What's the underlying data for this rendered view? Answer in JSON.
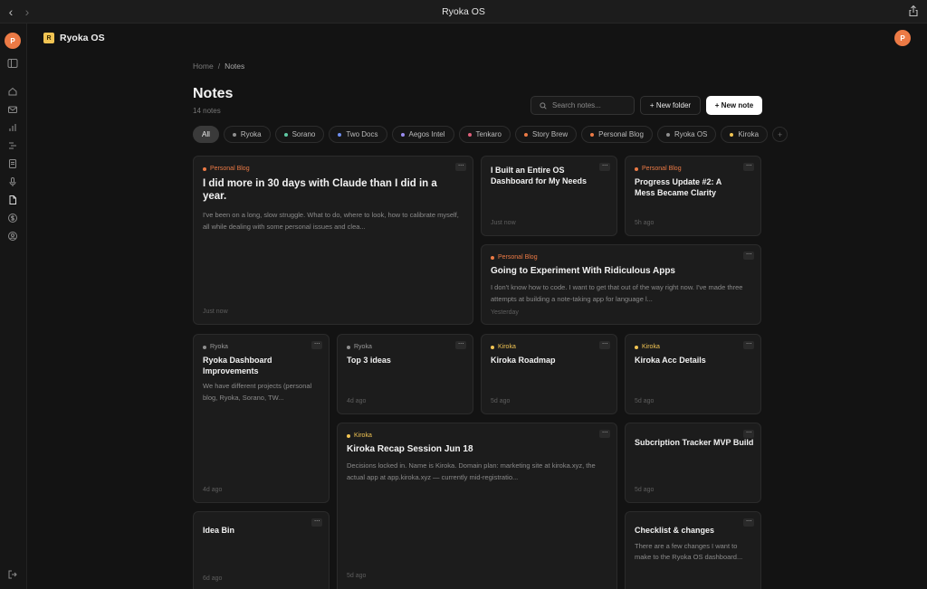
{
  "window": {
    "title": "Ryoka OS"
  },
  "rail": {
    "avatar": "P"
  },
  "app": {
    "logo": "R",
    "name": "Ryoka OS",
    "user_avatar": "P"
  },
  "breadcrumb": {
    "home": "Home",
    "sep": "/",
    "current": "Notes"
  },
  "page": {
    "title": "Notes",
    "count": "14 notes"
  },
  "search": {
    "placeholder": "Search notes..."
  },
  "buttons": {
    "new_folder": "+ New folder",
    "new_note": "+ New note"
  },
  "colors": {
    "accent": "#ec7a45",
    "kiroka": "#f1c453",
    "personal_blog": "#ec7a45",
    "ryoka": "#8f8f8f"
  },
  "filters": [
    {
      "label": "All",
      "color": ""
    },
    {
      "label": "Ryoka",
      "color": "#8f8f8f"
    },
    {
      "label": "Sorano",
      "color": "#5fc9a3"
    },
    {
      "label": "Two Docs",
      "color": "#6f8ff0"
    },
    {
      "label": "Aegos Intel",
      "color": "#9a8cf0"
    },
    {
      "label": "Tenkaro",
      "color": "#e0607a"
    },
    {
      "label": "Story Brew",
      "color": "#ec7a45"
    },
    {
      "label": "Personal Blog",
      "color": "#ec7a45"
    },
    {
      "label": "Ryoka OS",
      "color": "#8f8f8f"
    },
    {
      "label": "Kiroka",
      "color": "#f1c453"
    }
  ],
  "notes": [
    {
      "tag": "Personal Blog",
      "title": "I did more in 30 days with Claude than I did in a year.",
      "excerpt": "I've been on a long, slow struggle. What to do, where to look, how to calibrate myself, all while dealing with some personal issues and clea...",
      "time": "Just now"
    },
    {
      "tag": "",
      "title": "I Built an Entire OS Dashboard for My Needs",
      "excerpt": "",
      "time": "Just now"
    },
    {
      "tag": "Personal Blog",
      "title": "Progress Update #2: A Mess Became Clarity",
      "excerpt": "",
      "time": "5h ago"
    },
    {
      "tag": "Personal Blog",
      "title": "Going to Experiment With Ridiculous Apps",
      "excerpt": "I don't know how to code. I want to get that out of the way right now. I've made three attempts at building a note-taking app for language l...",
      "time": "Yesterday"
    },
    {
      "tag": "Ryoka",
      "title": "Ryoka Dashboard Improvements",
      "excerpt": "We have different projects (personal blog, Ryoka, Sorano, TW...",
      "time": "4d ago"
    },
    {
      "tag": "Ryoka",
      "title": "Top 3 ideas",
      "excerpt": "",
      "time": "4d ago"
    },
    {
      "tag": "Kiroka",
      "title": "Kiroka Roadmap",
      "excerpt": "",
      "time": "5d ago"
    },
    {
      "tag": "Kiroka",
      "title": "Kiroka Acc Details",
      "excerpt": "",
      "time": "5d ago"
    },
    {
      "tag": "Kiroka",
      "title": "Kiroka Recap Session Jun 18",
      "excerpt": "Decisions locked in. Name is Kiroka. Domain plan: marketing site at kiroka.xyz, the actual app at app.kiroka.xyz — currently mid-registratio...",
      "time": "5d ago"
    },
    {
      "tag": "",
      "title": "Subcription Tracker MVP Build",
      "excerpt": "",
      "time": "5d ago"
    },
    {
      "tag": "",
      "title": "Idea Bin",
      "excerpt": "",
      "time": "6d ago"
    },
    {
      "tag": "",
      "title": "Checklist & changes",
      "excerpt": "There are a few changes I want to make to the Ryoka OS dashboard...",
      "time": ""
    }
  ],
  "card_menu": "···"
}
